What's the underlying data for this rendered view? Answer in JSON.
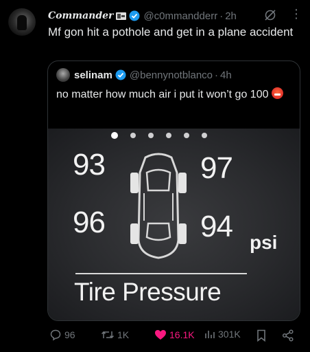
{
  "post": {
    "display_name": "Commander",
    "handle": "@c0mmandderr",
    "separator": "·",
    "time": "2h",
    "more_icon": "⋮",
    "text": "Mf gon hit a pothole and get in a plane accident"
  },
  "quoted": {
    "display_name": "selinam",
    "handle": "@bennynotblanco",
    "separator": "·",
    "time": "4h",
    "text": "no matter how much air i put it won’t go 100",
    "image": {
      "front_left": "93",
      "front_right": "97",
      "rear_left": "96",
      "rear_right": "94",
      "unit": "psi",
      "title": "Tire Pressure"
    }
  },
  "actions": {
    "replies": "96",
    "reposts": "1K",
    "likes": "16.1K",
    "views": "301K"
  },
  "colors": {
    "background": "#000000",
    "text": "#e7e9ea",
    "muted": "#71767b",
    "verified": "#1d9bf0",
    "like": "#f91880"
  }
}
